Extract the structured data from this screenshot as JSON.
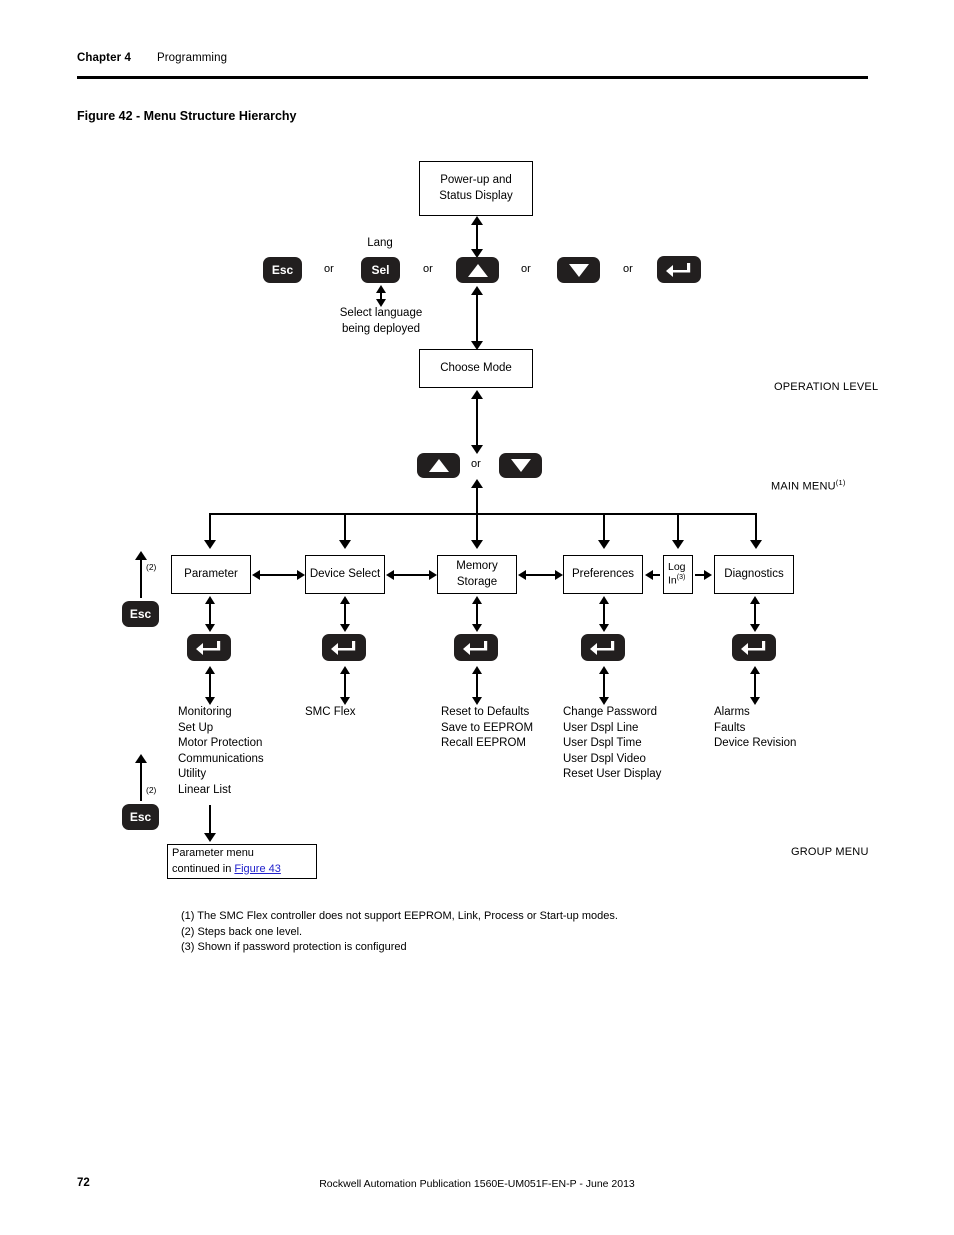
{
  "header": {
    "chapter": "Chapter 4",
    "section": "Programming"
  },
  "figure": {
    "title": "Figure 42 - Menu Structure Hierarchy"
  },
  "nodes": {
    "powerup": "Power-up and\nStatus Display",
    "choose_mode": "Choose Mode",
    "parameter": "Parameter",
    "device_select": "Device Select",
    "memory_storage": "Memory\nStorage",
    "preferences": "Preferences",
    "log_in": "Log\nIn",
    "log_in_note": "(3)",
    "diagnostics": "Diagnostics",
    "continued": "Parameter menu\ncontinued in ",
    "continued_link": "Figure 43"
  },
  "keys": {
    "esc": "Esc",
    "sel": "Sel",
    "lang": "Lang",
    "up": "up-arrow",
    "down": "down-arrow",
    "enter": "enter-arrow",
    "esc_left_1": "Esc",
    "esc_left_2": "Esc"
  },
  "annotations": {
    "or": "or",
    "select_language": "Select language\nbeing deployed",
    "note2_a": "(2)",
    "note2_b": "(2)"
  },
  "levels": {
    "operation": "OPERATION LEVEL",
    "main_menu": "MAIN MENU",
    "main_menu_note": "(1)",
    "group_menu": "GROUP MENU"
  },
  "groups": {
    "parameter": "Monitoring\nSet Up\nMotor Protection\nCommunications\nUtility\nLinear List",
    "device_select": "SMC Flex",
    "memory_storage": "Reset to Defaults\nSave to EEPROM\nRecall EEPROM",
    "preferences": "Change Password\nUser Dspl Line\nUser Dspl Time\nUser Dspl Video\nReset User Display",
    "diagnostics": "Alarms\nFaults\nDevice Revision"
  },
  "footnotes": {
    "n1": "(1) The SMC Flex controller does not support EEPROM, Link, Process or Start-up modes.",
    "n2": "(2) Steps back one level.",
    "n3": "(3) Shown if password protection is configured"
  },
  "footer": {
    "page_number": "72",
    "publication": "Rockwell Automation Publication 1560E-UM051F-EN-P - June 2013"
  }
}
